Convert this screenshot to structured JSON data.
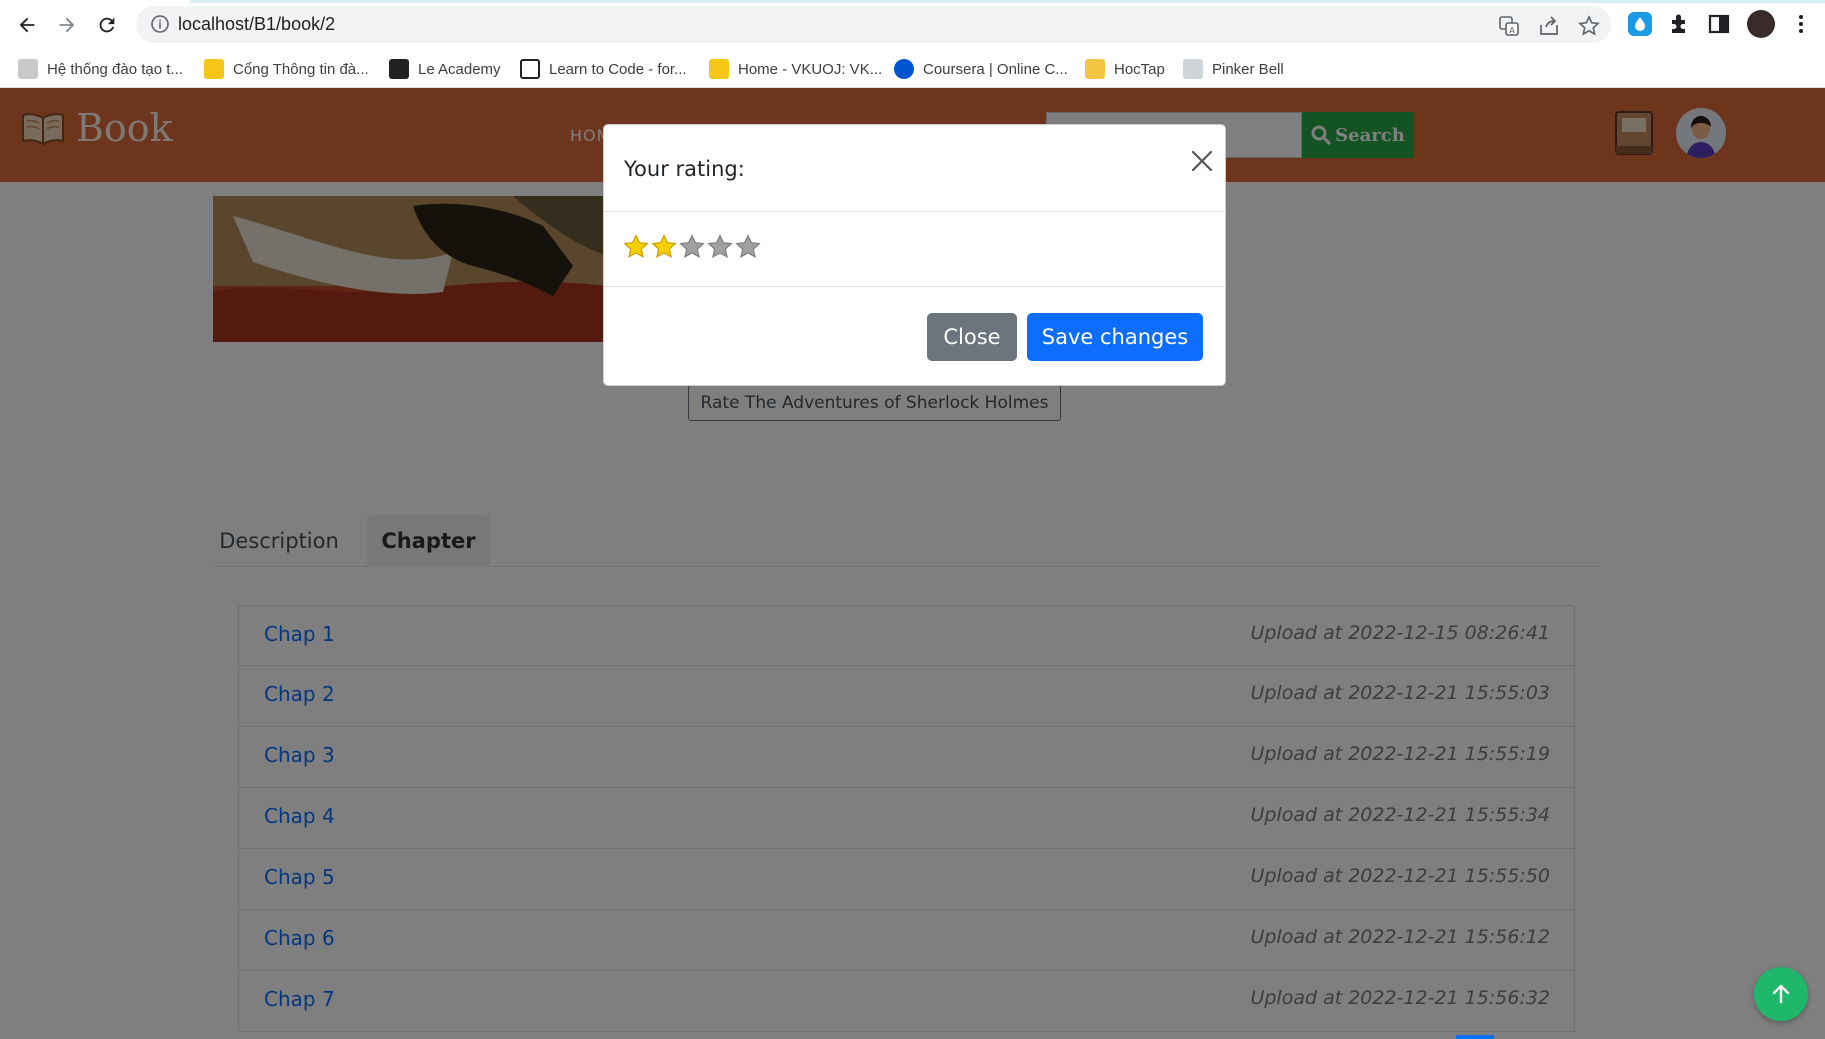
{
  "browser": {
    "url": "localhost/B1/book/2",
    "bookmarks": [
      {
        "label": "Hệ thống đào tạo t...",
        "icon": "document-favicon",
        "color": "#8a8a8a"
      },
      {
        "label": "Cổng Thông tin đà...",
        "icon": "vku-favicon",
        "color": "#f5c518"
      },
      {
        "label": "Le Academy",
        "icon": "c-favicon",
        "color": "#222222"
      },
      {
        "label": "Learn to Code - for...",
        "icon": "code-favicon",
        "color": "#222222"
      },
      {
        "label": "Home - VKUOJ: VK...",
        "icon": "vku-favicon",
        "color": "#f5c518"
      },
      {
        "label": "Coursera | Online C...",
        "icon": "coursera-favicon",
        "color": "#0056d2"
      },
      {
        "label": "HocTap",
        "icon": "folder-icon",
        "color": "#f4c542"
      },
      {
        "label": "Pinker Bell",
        "icon": "pinker-favicon",
        "color": "#9aa0a6"
      }
    ]
  },
  "header": {
    "logo_text": "Book",
    "nav_home": "HOME",
    "search_placeholder": "",
    "search_label": "Search"
  },
  "book": {
    "rate_button": "Rate The Adventures of Sherlock Holmes"
  },
  "tabs": [
    {
      "label": "Description",
      "active": false
    },
    {
      "label": "Chapter",
      "active": true
    }
  ],
  "chapters": [
    {
      "title": "Chap 1",
      "uploaded": "Upload at 2022-12-15 08:26:41"
    },
    {
      "title": "Chap 2",
      "uploaded": "Upload at 2022-12-21 15:55:03"
    },
    {
      "title": "Chap 3",
      "uploaded": "Upload at 2022-12-21 15:55:19"
    },
    {
      "title": "Chap 4",
      "uploaded": "Upload at 2022-12-21 15:55:34"
    },
    {
      "title": "Chap 5",
      "uploaded": "Upload at 2022-12-21 15:55:50"
    },
    {
      "title": "Chap 6",
      "uploaded": "Upload at 2022-12-21 15:56:12"
    },
    {
      "title": "Chap 7",
      "uploaded": "Upload at 2022-12-21 15:56:32"
    }
  ],
  "modal": {
    "title": "Your rating:",
    "rating": 2,
    "max_rating": 5,
    "close_label": "Close",
    "save_label": "Save changes"
  },
  "colors": {
    "header_bg": "#dd6b3b",
    "search_btn": "#28a745",
    "primary": "#0d6efd",
    "secondary": "#6c757d",
    "star_on": "#f5d000",
    "star_off": "#a0a0a0",
    "to_top": "#1fb86a"
  }
}
